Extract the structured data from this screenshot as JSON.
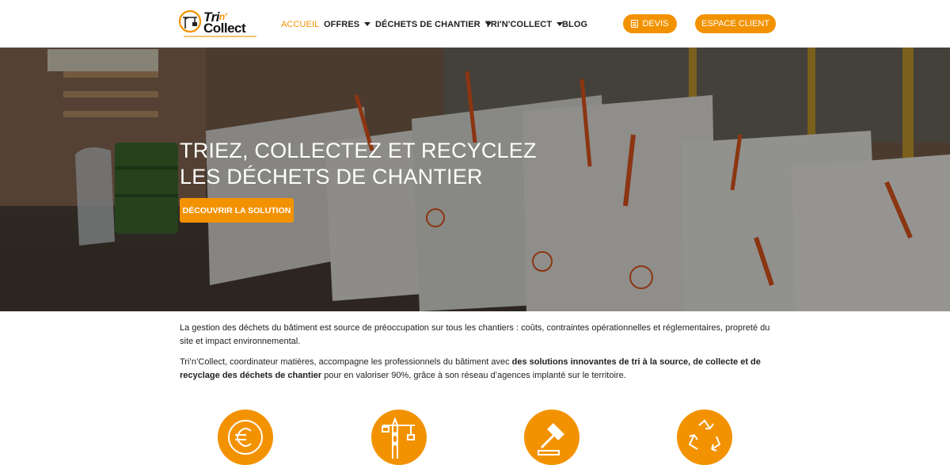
{
  "header": {
    "logo": {
      "word1": "Tri",
      "word1_accent": "n'",
      "word2": "Collect"
    },
    "nav": [
      {
        "label": "ACCUEIL",
        "active": true,
        "has_dropdown": false
      },
      {
        "label": "OFFRES",
        "active": false,
        "has_dropdown": true
      },
      {
        "label": "DÉCHETS DE CHANTIER",
        "active": false,
        "has_dropdown": true
      },
      {
        "label": "TRI'N'COLLECT",
        "active": false,
        "has_dropdown": true
      },
      {
        "label": "BLOG",
        "active": false,
        "has_dropdown": false
      }
    ],
    "devis_button": {
      "label": "DEVIS",
      "icon": "document-icon"
    },
    "client_button": {
      "label": "ESPACE CLIENT"
    }
  },
  "hero": {
    "title_line1": "TRIEZ, COLLECTEZ ET RECYCLEZ",
    "title_line2": "LES DÉCHETS DE CHANTIER",
    "cta_label": "DÉCOUVRIR LA SOLUTION",
    "background": "construction-site-photo-with-waste-sorting-bags"
  },
  "intro": {
    "paragraph1": "La gestion des déchets du bâtiment est source de préoccupation sur tous les chantiers : coûts, contraintes opérationnelles et réglementaires, propreté du site et impact environnemental.",
    "paragraph2_start": "Tri’n’Collect, coordinateur matières, accompagne les professionnels du bâtiment avec ",
    "paragraph2_bold1": "des solutions innovantes de tri à la source",
    "paragraph2_mid1": ", ",
    "paragraph2_bold2": "de collecte",
    "paragraph2_mid2": " et ",
    "paragraph2_bold3": "de recyclage des déchets de chantier",
    "paragraph2_end": " pour en valoriser 90%, grâce à son réseau d’agences implanté sur le territoire."
  },
  "features": [
    {
      "icon": "euro-icon"
    },
    {
      "icon": "crane-icon"
    },
    {
      "icon": "gavel-icon"
    },
    {
      "icon": "recycle-icon"
    }
  ],
  "colors": {
    "accent": "#f39200",
    "text": "#222222",
    "header_bg": "#ffffff"
  }
}
